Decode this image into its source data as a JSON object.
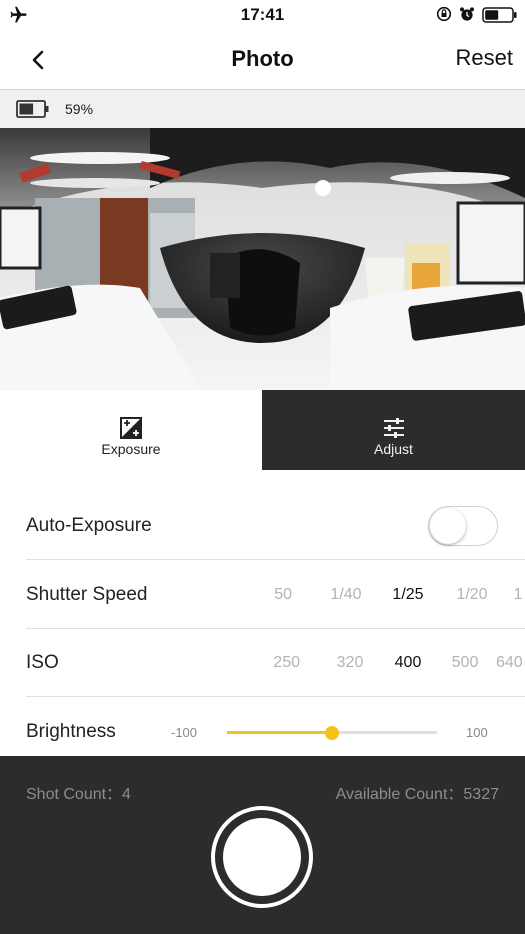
{
  "status_bar": {
    "time": "17:41",
    "icons": [
      "airplane-mode-icon",
      "rotation-lock-icon",
      "alarm-icon",
      "battery-icon"
    ]
  },
  "nav": {
    "back_icon": "chevron-left-icon",
    "title": "Photo",
    "reset_label": "Reset"
  },
  "camera_battery": {
    "icon": "battery-icon",
    "percent_text": "59%",
    "level": 0.59
  },
  "preview": {
    "description_icon": "panorama-preview-image"
  },
  "tabs": [
    {
      "label": "Exposure",
      "icon": "exposure-icon",
      "active": true
    },
    {
      "label": "Adjust",
      "icon": "sliders-icon",
      "active": false
    }
  ],
  "settings": {
    "auto_exposure": {
      "label": "Auto-Exposure",
      "enabled": false
    },
    "shutter_speed": {
      "label": "Shutter Speed",
      "options": [
        "50",
        "1/40",
        "1/25",
        "1/20",
        "1"
      ],
      "selected": "1/25"
    },
    "iso": {
      "label": "ISO",
      "options": [
        "250",
        "320",
        "400",
        "500",
        "640"
      ],
      "selected": "400"
    },
    "brightness": {
      "label": "Brightness",
      "min_label": "-100",
      "max_label": "100",
      "min": -100,
      "max": 100,
      "value": 0
    }
  },
  "footer": {
    "shot_count_text": "Shot Count：4",
    "available_count_text": "Available Count：5327"
  },
  "colors": {
    "accent": "#f5c21b",
    "dark_panel": "#2c2c2c",
    "divider": "#e2e2e2"
  }
}
